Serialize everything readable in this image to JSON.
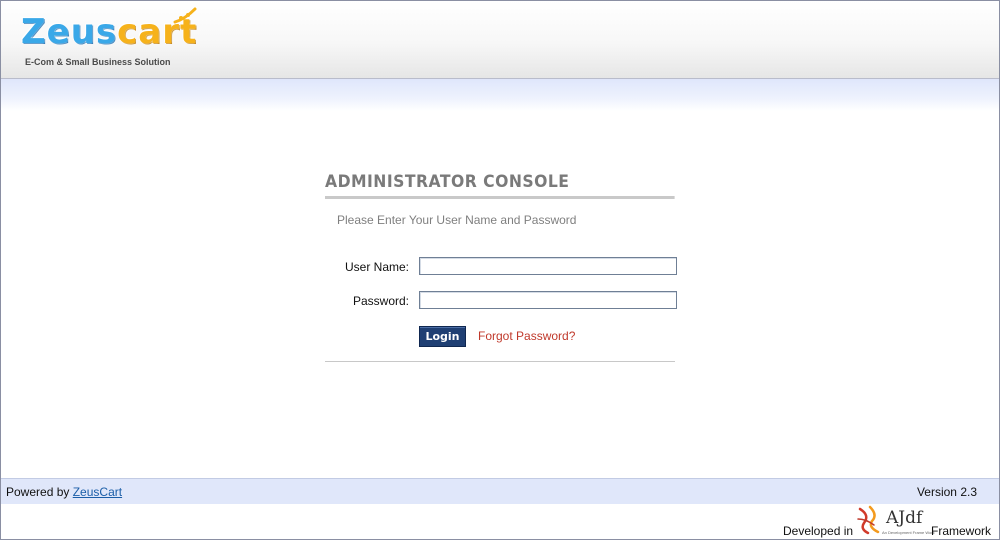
{
  "header": {
    "logo_part1": "Zeus",
    "logo_part2": "cart",
    "tagline": "E-Com & Small Business Solution"
  },
  "login": {
    "title": "ADMINISTRATOR CONSOLE",
    "subtitle": "Please Enter Your User Name and Password",
    "username_label": "User Name:",
    "username_value": "",
    "password_label": "Password:",
    "password_value": "",
    "login_button": "Login",
    "forgot_link": "Forgot Password?"
  },
  "footer": {
    "powered_by": "Powered by",
    "powered_link": "ZeusCart",
    "version": "Version 2.3",
    "developed_in": "Developed in",
    "framework_logo_text": "AJdf",
    "framework_logo_tagline": "An Development Frame Work",
    "framework": "Framework"
  },
  "colors": {
    "logo_blue": "#3aa8e8",
    "logo_orange": "#f6b21b",
    "button_bg": "#1f3f73",
    "link_red": "#c0392b",
    "footer_bar": "#e0e7fa"
  }
}
